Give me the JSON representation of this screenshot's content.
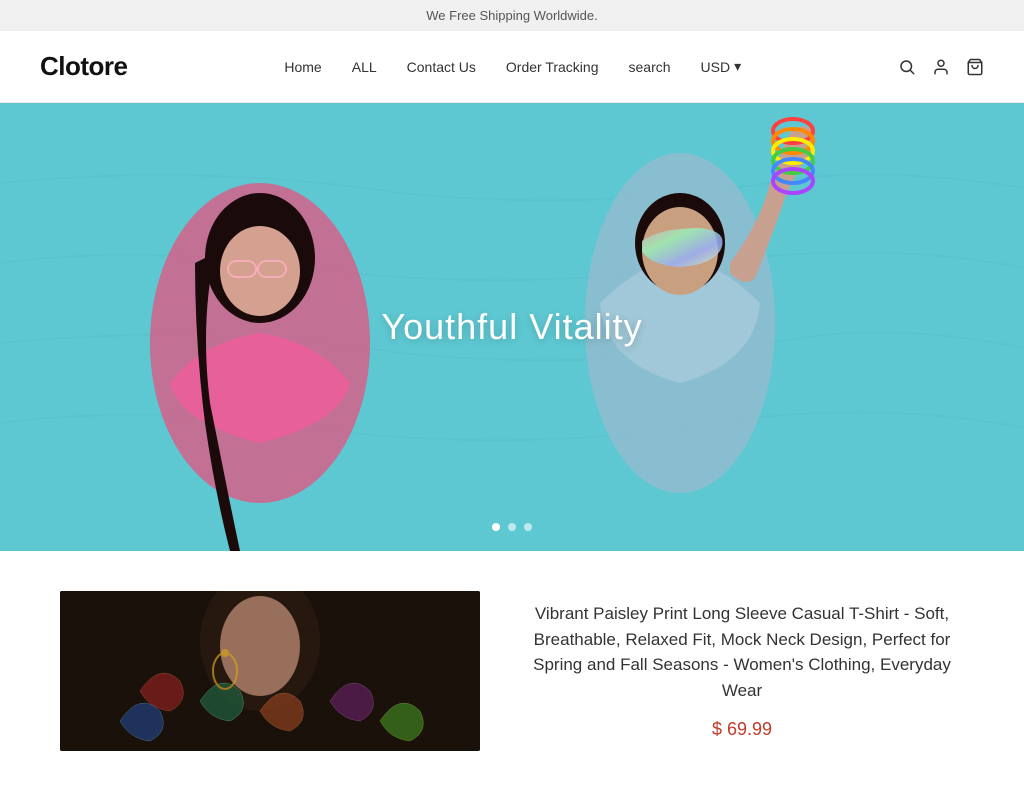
{
  "announcement": {
    "text": "We Free Shipping Worldwide."
  },
  "header": {
    "logo": "Clotore",
    "nav": [
      {
        "label": "Home",
        "id": "home"
      },
      {
        "label": "ALL",
        "id": "all"
      },
      {
        "label": "Contact Us",
        "id": "contact"
      },
      {
        "label": "Order Tracking",
        "id": "order-tracking"
      },
      {
        "label": "search",
        "id": "search-link"
      }
    ],
    "currency": "USD",
    "currency_arrow": "▾"
  },
  "hero": {
    "title": "Youthful Vitality",
    "dots": [
      1,
      2,
      3
    ],
    "active_dot": 0
  },
  "product": {
    "title": "Vibrant Paisley Print Long Sleeve Casual T-Shirt - Soft, Breathable, Relaxed Fit, Mock Neck Design, Perfect for Spring and Fall Seasons - Women's Clothing, Everyday Wear",
    "price": "$ 69.99"
  },
  "icons": {
    "search": "🔍",
    "user": "👤",
    "cart": "🛒"
  }
}
